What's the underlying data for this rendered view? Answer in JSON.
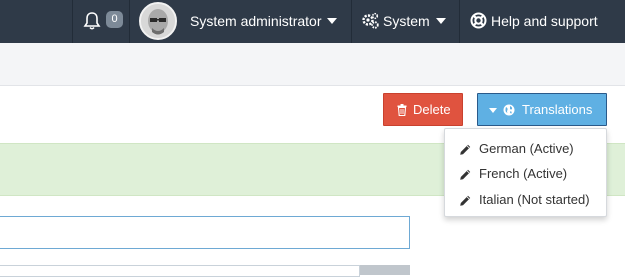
{
  "topbar": {
    "notification_count": "0",
    "user_name": "System administrator",
    "system_label": "System",
    "help_label": "Help and support",
    "icons": {
      "bell": "bell-icon",
      "user_caret": "caret-down-icon",
      "system": "gears-icon",
      "system_caret": "caret-down-icon",
      "help": "lifebuoy-icon"
    }
  },
  "actions": {
    "delete_label": "Delete",
    "translations_label": "Translations",
    "icons": {
      "delete": "trash-icon",
      "translations_caret": "caret-down-icon",
      "translations": "globe-icon"
    }
  },
  "translations_menu": {
    "items": [
      {
        "label": "German (Active)",
        "icon": "pencil-icon"
      },
      {
        "label": "French (Active)",
        "icon": "pencil-icon"
      },
      {
        "label": "Italian (Not started)",
        "icon": "pencil-icon"
      }
    ]
  },
  "colors": {
    "navbar": "#2f3a48",
    "delete": "#e0533f",
    "translations": "#5fb0e3",
    "alert": "#dff0d8"
  }
}
